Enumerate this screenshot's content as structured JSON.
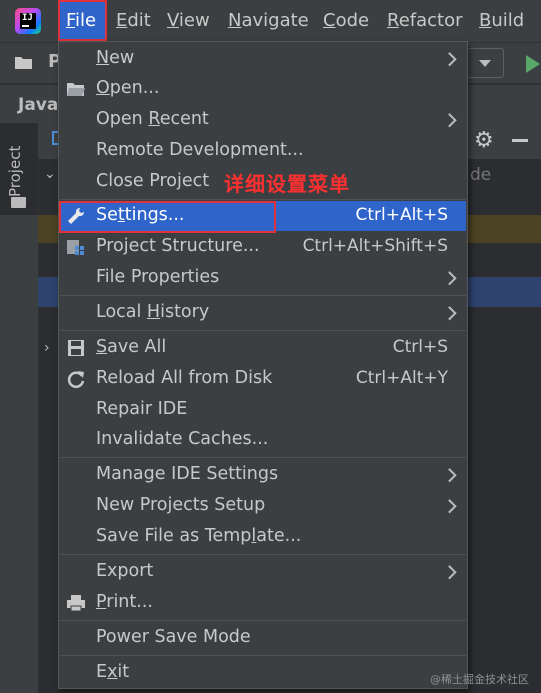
{
  "menubar": {
    "items": [
      {
        "text": "File",
        "u": "F",
        "rest": "ile"
      },
      {
        "text": "Edit",
        "u": "E",
        "rest": "dit"
      },
      {
        "text": "View",
        "u": "V",
        "rest": "iew"
      },
      {
        "text": "Navigate",
        "u": "N",
        "rest": "avigate"
      },
      {
        "text": "Code",
        "u": "C",
        "rest": "ode"
      },
      {
        "text": "Refactor",
        "u": "R",
        "rest": "efactor"
      },
      {
        "text": "Build",
        "u": "B",
        "rest": "uild"
      }
    ]
  },
  "background": {
    "toolbar_text": "P",
    "breadcrumb": "Java",
    "project_tab": "Project",
    "tree_fragment": "de"
  },
  "file_menu": {
    "new": {
      "pre": "",
      "u": "N",
      "post": "ew"
    },
    "open": {
      "pre": "",
      "u": "O",
      "post": "pen..."
    },
    "open_recent": {
      "pre": "Open ",
      "u": "R",
      "post": "ecent"
    },
    "remote_development": "Remote Development...",
    "close_project": "Close Project",
    "settings": {
      "pre": "Se",
      "u": "t",
      "post": "tings...",
      "shortcut": "Ctrl+Alt+S"
    },
    "project_structure": {
      "text": "Project Structure...",
      "shortcut": "Ctrl+Alt+Shift+S"
    },
    "file_properties": "File Properties",
    "local_history": {
      "pre": "Local ",
      "u": "H",
      "post": "istory"
    },
    "save_all": {
      "pre": "",
      "u": "S",
      "post": "ave All",
      "shortcut": "Ctrl+S"
    },
    "reload": {
      "text": "Reload All from Disk",
      "shortcut": "Ctrl+Alt+Y"
    },
    "repair_ide": "Repair IDE",
    "invalidate_caches": "Invalidate Caches...",
    "manage_ide_settings": "Manage IDE Settings",
    "new_projects_setup": "New Projects Setup",
    "save_as_template": {
      "pre": "Save File as Temp",
      "u": "l",
      "post": "ate..."
    },
    "export": "Export",
    "print": {
      "pre": "",
      "u": "P",
      "post": "rint..."
    },
    "power_save_mode": "Power Save Mode",
    "exit": {
      "pre": "E",
      "u": "x",
      "post": "it"
    }
  },
  "annotation": "详细设置菜单",
  "watermark": "@稀土掘金技术社区",
  "colors": {
    "accent": "#2f65ca",
    "highlight_border": "#e0323c",
    "annotation": "#ff3030"
  }
}
